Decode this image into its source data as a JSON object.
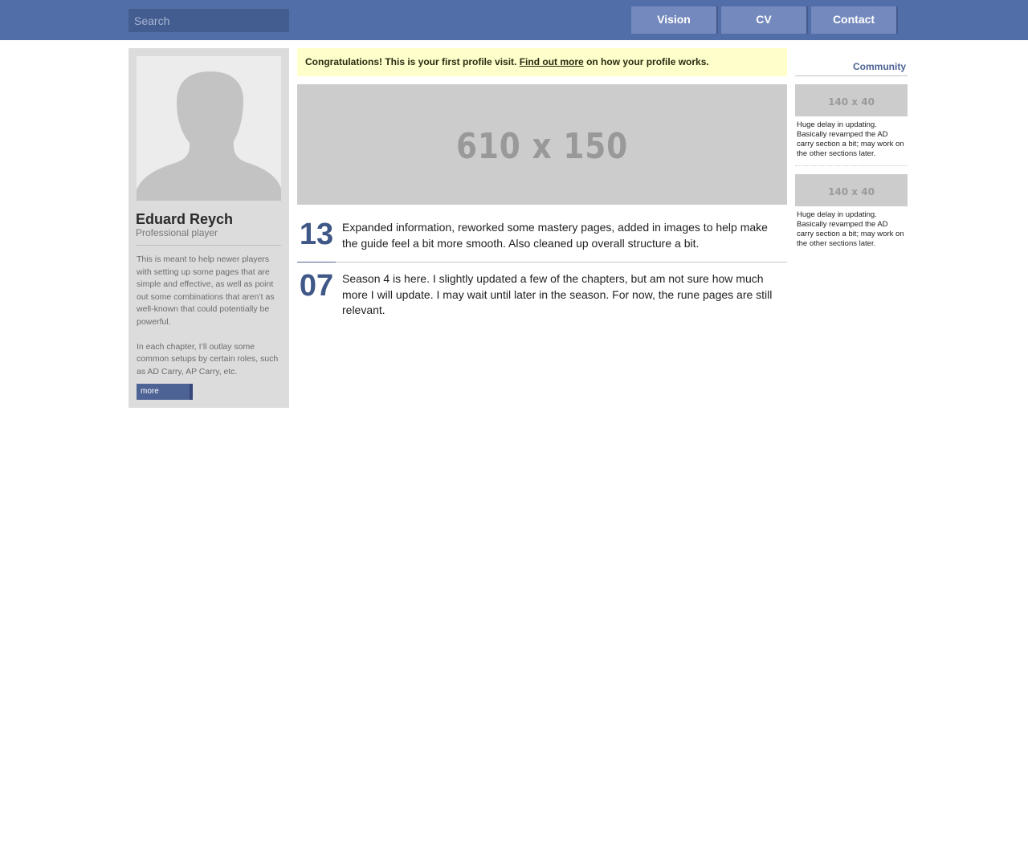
{
  "header": {
    "search_placeholder": "Search",
    "nav": [
      {
        "label": "Vision"
      },
      {
        "label": "CV"
      },
      {
        "label": "Contact"
      }
    ]
  },
  "profile": {
    "name": "Eduard Reych",
    "role": "Professional player",
    "bio": [
      "This is meant to help newer players with setting up some pages that are simple and effective, as well as point out some combinations that aren’t as well-known that could potentially be powerful.",
      "In each chapter, I’ll outlay some common setups by certain roles, such as AD Carry, AP Carry, etc."
    ],
    "more_label": "more"
  },
  "notice": {
    "text_before": "Congratulations! This is your first profile visit.",
    "link": "Find out more",
    "text_after": "on how your profile works."
  },
  "banner": {
    "label": "610 x 150"
  },
  "entries": [
    {
      "day": "13",
      "text": "Expanded information, reworked some mastery pages, added in images to help make the guide feel a bit more smooth. Also cleaned up overall structure a bit."
    },
    {
      "day": "07",
      "text": "Season 4 is here. I slightly updated a few of the chapters, but am not sure how much more I will update. I may wait until later in the season. For now, the rune pages are still relevant."
    }
  ],
  "community": {
    "title": "Community",
    "items": [
      {
        "thumb_label": "140 x 40",
        "text": "Huge delay in updating. Basically revamped the AD carry section a bit; may work on the other sections later."
      },
      {
        "thumb_label": "140 x 40",
        "text": "Huge delay in updating. Basically revamped the AD carry section a bit; may work on the other sections later."
      }
    ]
  },
  "colors": {
    "topbar": "#516ea8",
    "accent": "#3f5888",
    "notice_bg": "#ffffcc",
    "placeholder_gray": "#cccccc"
  }
}
